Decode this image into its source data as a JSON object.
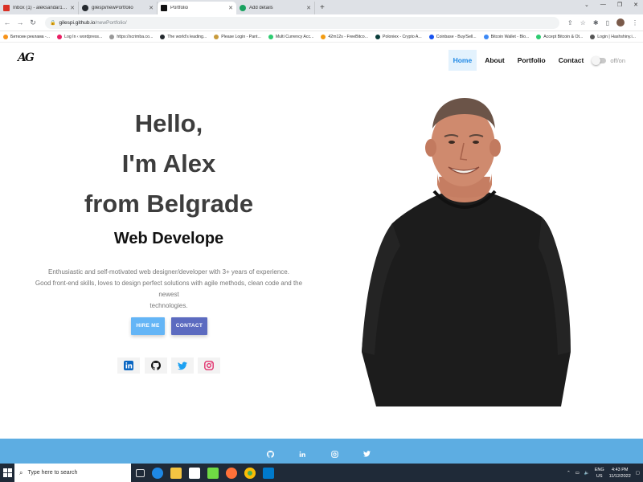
{
  "browser": {
    "tabs": [
      {
        "title": "Inbox (1) - aleksandar120771...",
        "favicon_color": "#d93025",
        "active": false
      },
      {
        "title": "gilespi/newPortfolio",
        "favicon_color": "#24292e",
        "active": false
      },
      {
        "title": "Portfolio",
        "favicon_color": "#111111",
        "active": true
      },
      {
        "title": "Add details",
        "favicon_color": "#1aa260",
        "active": false
      }
    ],
    "new_tab": "+",
    "url_host": "gilespi.github.io",
    "url_path": "/newPortfolio/",
    "bookmarks": [
      {
        "label": "Биткоин реклама -...",
        "color": "#f7931a"
      },
      {
        "label": "Log In ‹ wordpress...",
        "color": "#e91e63"
      },
      {
        "label": "https://scrimba.co...",
        "color": "#999999"
      },
      {
        "label": "The world's leading...",
        "color": "#24292e"
      },
      {
        "label": "Please Login - Pant...",
        "color": "#c89b3c"
      },
      {
        "label": "Multi Currency Acc...",
        "color": "#2ecc71"
      },
      {
        "label": "42m12s - FreeBitco...",
        "color": "#f39c12"
      },
      {
        "label": "Poloniex - Crypto A...",
        "color": "#0a3d3a"
      },
      {
        "label": "Coinbase - Buy/Sell...",
        "color": "#1652f0"
      },
      {
        "label": "Bitcoin Wallet - Blo...",
        "color": "#3d89f5"
      },
      {
        "label": "Accept Bitcoin & Ot...",
        "color": "#2ecc71"
      },
      {
        "label": "Login | Hashshiny.i...",
        "color": "#555555"
      }
    ]
  },
  "site": {
    "logo": "AG",
    "nav": [
      {
        "label": "Home",
        "active": true
      },
      {
        "label": "About",
        "active": false
      },
      {
        "label": "Portfolio",
        "active": false
      },
      {
        "label": "Contact",
        "active": false
      }
    ],
    "theme_toggle_label": "off/on",
    "hero": {
      "line1": "Hello,",
      "line2": "I'm Alex",
      "line3": "from Belgrade",
      "role": "Web Develope",
      "desc1": "Enthusiastic and self-motivated web designer/developer with 3+ years of experience.",
      "desc2": "Good front-end skills, loves to design perfect solutions with agile methods, clean code and the newest",
      "desc3": "technologies.",
      "hire_button": "HIRE ME",
      "contact_button": "CONTACT"
    },
    "social_icons": [
      "linkedin-icon",
      "github-icon",
      "twitter-icon",
      "instagram-icon"
    ],
    "footer_icons": [
      "github-icon",
      "linkedin-icon",
      "instagram-icon",
      "twitter-icon"
    ]
  },
  "taskbar": {
    "search_placeholder": "Type here to search",
    "lang": "ENG",
    "region": "US",
    "time": "4:43 PM",
    "date": "11/12/2022"
  },
  "colors": {
    "accent": "#1e88e5",
    "hire": "#64b5f6",
    "contact": "#5c6bc0",
    "footer": "#5dade2"
  }
}
